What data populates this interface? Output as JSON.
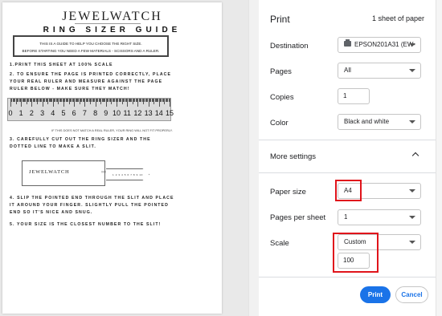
{
  "preview": {
    "brand": "JEWELWATCH",
    "guide_title": "RING SIZER GUIDE",
    "intro_line1": "THIS IS A GUIDE TO HELP YOU CHOOSE THE RIGHT SIZE.",
    "intro_line2": "BEFORE STARTING YOU NEED A FEW MATERIALS - SCISSORS AND A RULER.",
    "step1": "1.PRINT THIS SHEET AT 100% SCALE",
    "step2": "2. TO ENSURE THE PAGE IS PRINTED CORRECTLY, PLACE YOUR REAL RULER AND MEASURE AGAINST THE PAGE RULER BELOW - MAKE SURE THEY MATCH!",
    "ruler_numbers": [
      "0",
      "1",
      "2",
      "3",
      "4",
      "5",
      "6",
      "7",
      "8",
      "9",
      "10",
      "11",
      "12",
      "13",
      "14",
      "15"
    ],
    "ruler_note": "IF THIS DOES NOT MATCH A REAL RULER, YOUR RING WILL NOT FIT PROPERLY.",
    "step3": "3. CAREFULLY CUT OUT THE RING SIZER AND THE DOTTED LINE TO MAKE A SLIT.",
    "sizer_brand": "JEWELWATCH",
    "sizer_marks": "|||||||||||||||||||||||",
    "sizer_scale": "1 2 3 4 5 6 7 8 9 10",
    "step4": "4. SLIP THE POINTED END THROUGH THE SLIT AND PLACE IT AROUND YOUR FINGER. SLIGHTLY PULL THE POINTED END SO IT'S NICE AND SNUG.",
    "step5": "5. YOUR SIZE IS THE CLOSEST NUMBER TO THE SLIT!"
  },
  "panel": {
    "title": "Print",
    "sheet_count": "1 sheet of paper",
    "destination_label": "Destination",
    "destination_value": "EPSON201A31 (EW-",
    "pages_label": "Pages",
    "pages_value": "All",
    "copies_label": "Copies",
    "copies_value": "1",
    "color_label": "Color",
    "color_value": "Black and white",
    "more_settings_label": "More settings",
    "paper_size_label": "Paper size",
    "paper_size_value": "A4",
    "pages_per_sheet_label": "Pages per sheet",
    "pages_per_sheet_value": "1",
    "scale_label": "Scale",
    "scale_value": "Custom",
    "scale_input": "100",
    "print_button": "Print",
    "cancel_button": "Cancel"
  },
  "colors": {
    "accent": "#1a73e8",
    "highlight": "#e0141b",
    "preview_bg": "#e9e9e9"
  },
  "icons": {
    "printer": "printer-icon",
    "dropdown": "chevron-down-icon",
    "collapse": "chevron-up-icon"
  }
}
